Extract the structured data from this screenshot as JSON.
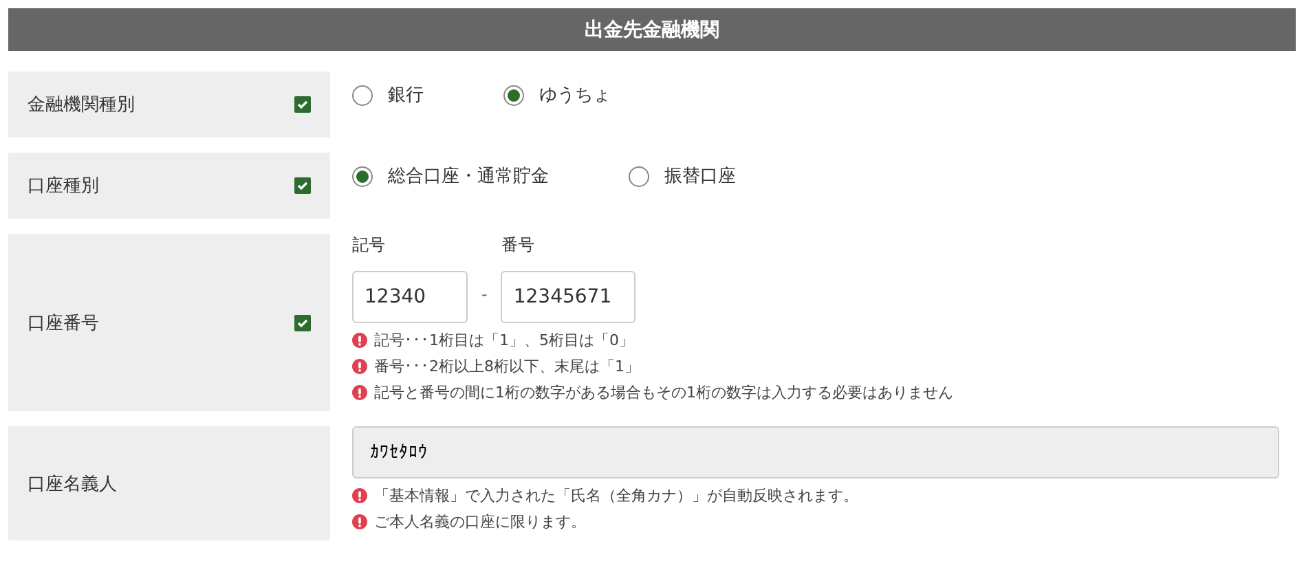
{
  "header": {
    "title": "出金先金融機関"
  },
  "rows": [
    {
      "kind": "radio",
      "label": "金融機関種別",
      "checked": true,
      "options": [
        {
          "label": "銀行",
          "selected": false
        },
        {
          "label": "ゆうちょ",
          "selected": true
        }
      ]
    },
    {
      "kind": "radio",
      "label": "口座種別",
      "checked": true,
      "options": [
        {
          "label": "総合口座・通常貯金",
          "selected": true
        },
        {
          "label": "振替口座",
          "selected": false
        }
      ]
    },
    {
      "kind": "account",
      "label": "口座番号",
      "checked": true,
      "fields": [
        {
          "label": "記号",
          "value": "12340"
        },
        {
          "label": "番号",
          "value": "12345671"
        }
      ],
      "separator": "-",
      "notes": [
        "記号･･･1桁目は「1」、5桁目は「0」",
        "番号･･･2桁以上8桁以下、末尾は「1」",
        "記号と番号の間に1桁の数字がある場合もその1桁の数字は入力する必要はありません"
      ]
    },
    {
      "kind": "name",
      "label": "口座名義人",
      "value": "ｶﾜｾﾀﾛｳ",
      "notes": [
        "「基本情報」で入力された「氏名（全角カナ）」が自動反映されます。",
        "ご本人名義の口座に限ります。"
      ]
    }
  ]
}
